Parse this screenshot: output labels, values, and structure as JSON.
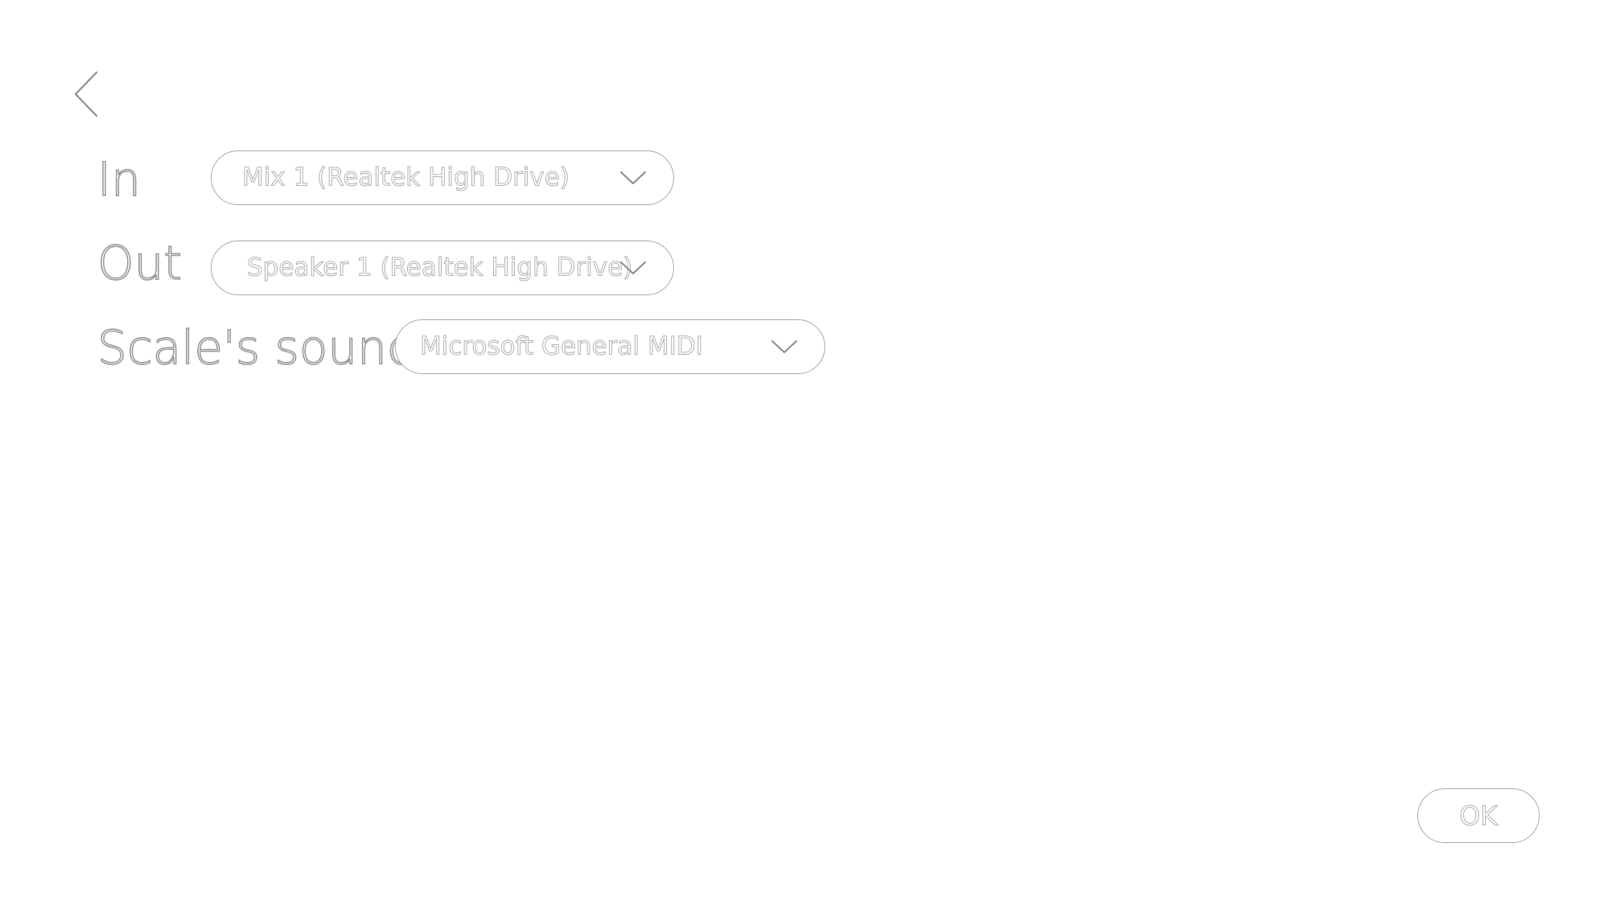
{
  "navigation": {
    "back_icon": "chevron-left-icon"
  },
  "settings": {
    "in": {
      "label": "In",
      "selected": "Mix 1 (Realtek High Drive)"
    },
    "out": {
      "label": "Out",
      "selected": "Speaker 1 (Realtek High Drive)"
    },
    "scale_sound": {
      "label": "Scale's sound",
      "selected": "Microsoft General MIDI"
    }
  },
  "actions": {
    "ok_label": "OK"
  },
  "colors": {
    "background": "#ffffff",
    "outline": "#a8a8a8",
    "text_stroke": "#9a9a9a"
  }
}
